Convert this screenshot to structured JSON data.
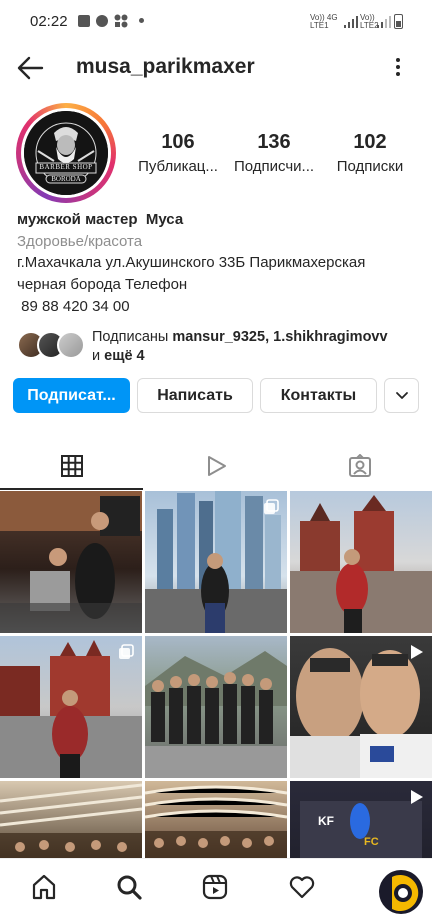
{
  "status_bar": {
    "time": "02:22",
    "sim1": "Vo)) 4G\nLTE1",
    "sim2": "Vo))\nLTE2"
  },
  "header": {
    "username": "musa_parikmaxer",
    "back_icon": "arrow-left-icon",
    "more_icon": "more-vertical-icon"
  },
  "avatar": {
    "logo_top": "BARBER SHOP",
    "logo_bottom": "BORODA"
  },
  "stats": [
    {
      "value": "106",
      "label": "Публикац..."
    },
    {
      "value": "136",
      "label": "Подписчи..."
    },
    {
      "value": "102",
      "label": "Подписки"
    }
  ],
  "bio": {
    "name": "мужской мастер  Муса",
    "category": "Здоровье/красота",
    "line1": "г.Махачкала ул.Акушинского 33Б Парикмахерская",
    "line2": "черная борода Телефон",
    "line3": " 89 88 420 34 00"
  },
  "followed_by": {
    "prefix": "Подписаны ",
    "user1": "mansur_9325",
    "sep": ", ",
    "user2": "1.shikhragimovv",
    "and": "и ",
    "more": "ещё 4"
  },
  "buttons": {
    "follow": "Подписат...",
    "message": "Написать",
    "contacts": "Контакты"
  },
  "tabs": [
    {
      "icon": "grid-icon",
      "active": true
    },
    {
      "icon": "reels-play-icon",
      "active": false
    },
    {
      "icon": "tagged-person-icon",
      "active": false
    }
  ],
  "colors": {
    "accent_blue": "#0095f6",
    "text": "#262626",
    "secondary_text": "#8e8e8e",
    "border": "#dbdbdb"
  },
  "grid_posts": [
    {
      "desc": "barbershop interior two men",
      "badge": "none"
    },
    {
      "desc": "moscow city skyscrapers man",
      "badge": "multiple-icon"
    },
    {
      "desc": "red square man red jacket",
      "badge": "none"
    },
    {
      "desc": "red square kremlin man",
      "badge": "multiple-icon"
    },
    {
      "desc": "group of men on mountain",
      "badge": "none"
    },
    {
      "desc": "two men face closeup",
      "badge": "reel-icon"
    },
    {
      "desc": "restaurant gathering",
      "badge": "none"
    },
    {
      "desc": "restaurant group photo",
      "badge": "none"
    },
    {
      "desc": "fight event stage",
      "badge": "reel-icon"
    }
  ],
  "bottom_nav": [
    {
      "icon": "home-icon"
    },
    {
      "icon": "search-icon"
    },
    {
      "icon": "reels-icon"
    },
    {
      "icon": "heart-icon"
    },
    {
      "icon": "profile-avatar-icon"
    }
  ]
}
